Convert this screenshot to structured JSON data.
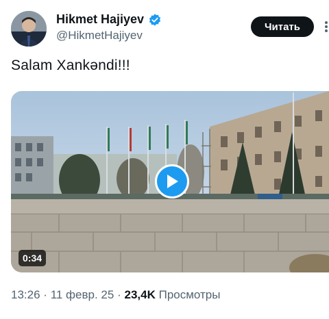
{
  "author": {
    "name": "Hikmet Hajiyev",
    "handle": "@HikmetHajiyev",
    "verified_color": "#1d9bf0"
  },
  "follow_label": "Читать",
  "tweet_text": "Salam Xankəndi!!!",
  "media": {
    "type": "video",
    "duration": "0:34",
    "play_icon": "play-icon"
  },
  "meta": {
    "time": "13:26",
    "date": "11 февр. 25",
    "views_count": "23,4K",
    "views_label": "Просмотры",
    "separator": "·"
  },
  "colors": {
    "accent": "#1d9bf0",
    "text": "#0f1419",
    "secondary_text": "#536471"
  }
}
